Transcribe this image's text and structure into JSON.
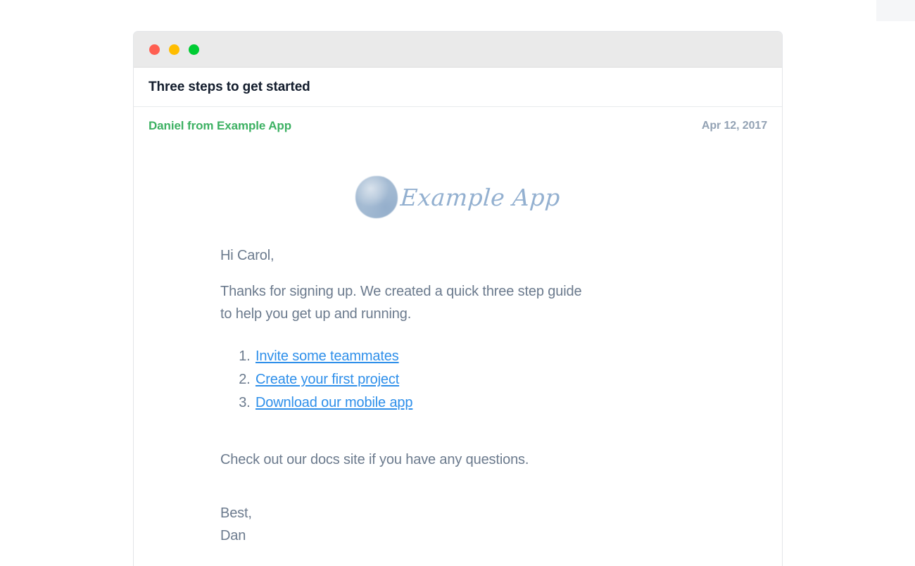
{
  "window": {
    "traffic_lights": [
      {
        "name": "close",
        "color": "#ff5f52"
      },
      {
        "name": "minimize",
        "color": "#ffbd00"
      },
      {
        "name": "maximize",
        "color": "#00cc33"
      }
    ]
  },
  "email": {
    "subject": "Three steps to get started",
    "sender": "Daniel from Example App",
    "date": "Apr 12, 2017",
    "logo": {
      "mark_icon": "watercolor-circle-icon",
      "wordmark": "Example App"
    },
    "greeting": "Hi Carol,",
    "intro": "Thanks for signing up. We created a quick three step guide to help you get up and running.",
    "steps": [
      "Invite some teammates",
      "Create your first project",
      "Download our mobile app"
    ],
    "docs_line": "Check out our docs site if you have any questions.",
    "signoff": "Best,",
    "signature": "Dan"
  },
  "colors": {
    "sender_green": "#3db163",
    "link_blue": "#2e8fea",
    "body_gray": "#6b7a8d",
    "date_gray": "#93a2b4",
    "subject_navy": "#121c2c",
    "logo_blue": "#93b0d0"
  }
}
